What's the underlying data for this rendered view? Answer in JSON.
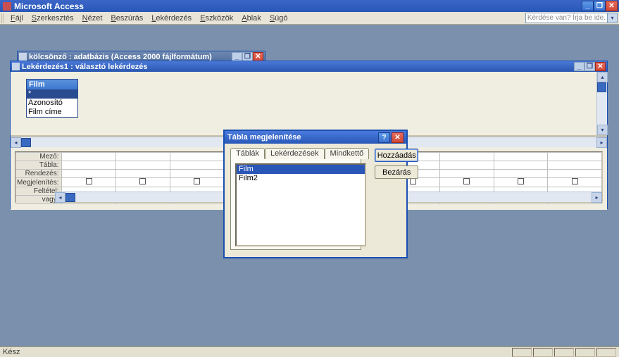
{
  "app": {
    "title": "Microsoft Access"
  },
  "menu": {
    "items": [
      "Fájl",
      "Szerkesztés",
      "Nézet",
      "Beszúrás",
      "Lekérdezés",
      "Eszközök",
      "Ablak",
      "Súgó"
    ],
    "help_placeholder": "Kérdése van? Írja be ide."
  },
  "status": {
    "text": "Kész"
  },
  "db_window": {
    "title": "kölcsönző : adatbázis (Access 2000 fájlformátum)"
  },
  "query_window": {
    "title": "Lekérdezés1 : választó lekérdezés",
    "field_list": {
      "title": "Film",
      "fields": [
        "*",
        "Azonosító",
        "Film címe"
      ]
    },
    "row_headers": [
      "Mező:",
      "Tábla:",
      "Rendezés:",
      "Megjelenítés:",
      "Feltétel:",
      "vagy:"
    ]
  },
  "dialog": {
    "title": "Tábla megjelenítése",
    "tabs": [
      "Táblák",
      "Lekérdezések",
      "Mindkettő"
    ],
    "items": [
      "Film",
      "Film2"
    ],
    "add_btn": "Hozzáadás",
    "close_btn": "Bezárás"
  }
}
